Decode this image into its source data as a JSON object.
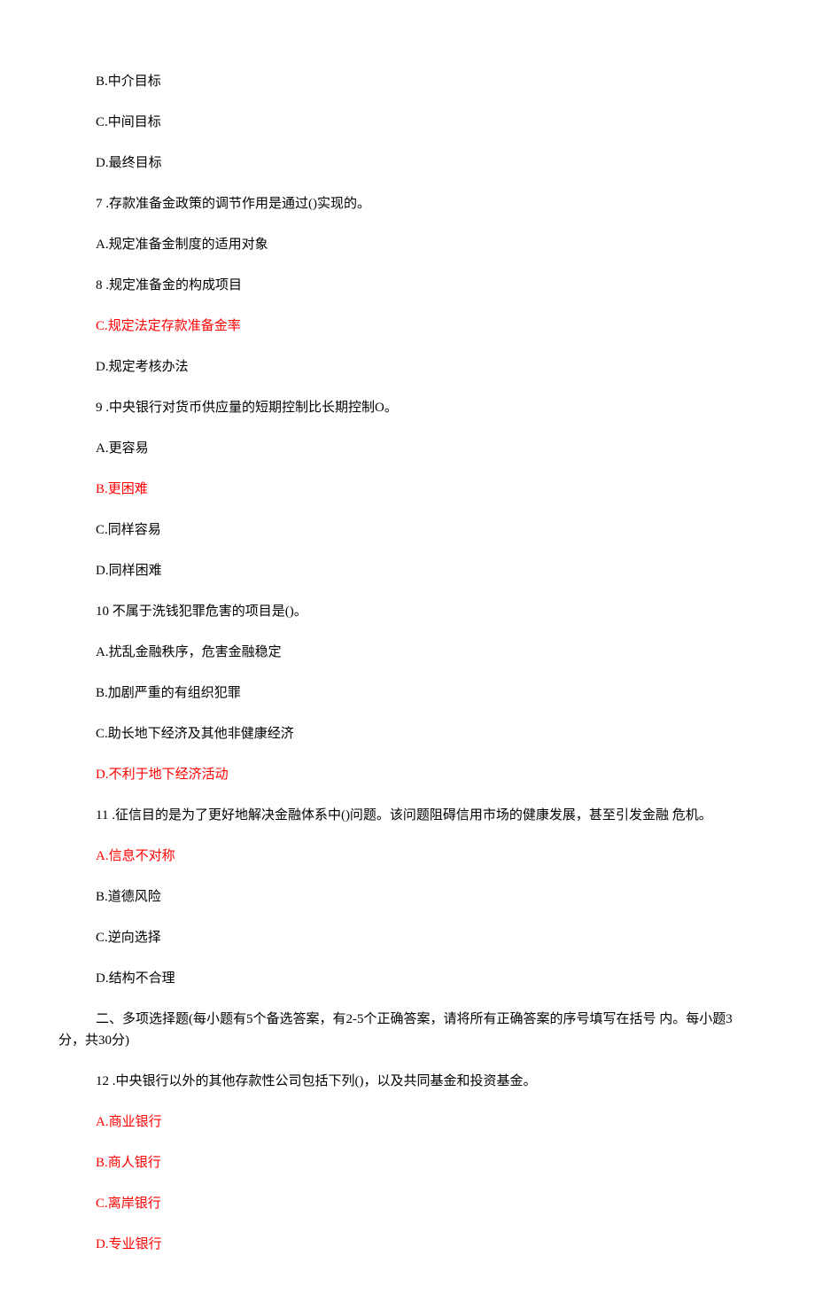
{
  "lines": {
    "l1": "B.中介目标",
    "l2": "C.中间目标",
    "l3": "D.最终目标",
    "l4": "7   .存款准备金政策的调节作用是通过()实现的。",
    "l5": "A.规定准备金制度的适用对象",
    "l6": "8   .规定准备金的构成项目",
    "l7": "C.规定法定存款准备金率",
    "l8": "D.规定考核办法",
    "l9": "9   .中央银行对货币供应量的短期控制比长期控制O。",
    "l10": "A.更容易",
    "l11": "B.更困难",
    "l12": "C.同样容易",
    "l13": "D.同样困难",
    "l14": "10   不属于洗钱犯罪危害的项目是()。",
    "l15": "A.扰乱金融秩序，危害金融稳定",
    "l16": "B.加剧严重的有组织犯罪",
    "l17": "C.助长地下经济及其他非健康经济",
    "l18": "D.不利于地下经济活动",
    "l19": "11   .征信目的是为了更好地解决金融体系中()问题。该问题阻碍信用市场的健康发展，甚至引发金融 危机。",
    "l20": "A.信息不对称",
    "l21": "B.道德风险",
    "l22": "C.逆向选择",
    "l23": "D.结构不合理",
    "l24": "二、多项选择题(每小题有5个备选答案，有2-5个正确答案，请将所有正确答案的序号填写在括号 内。每小题3分，共30分)",
    "l25": "12   .中央银行以外的其他存款性公司包括下列()，以及共同基金和投资基金。",
    "l26": "A.商业银行",
    "l27": "B.商人银行",
    "l28": "C.离岸银行",
    "l29": "D.专业银行"
  }
}
